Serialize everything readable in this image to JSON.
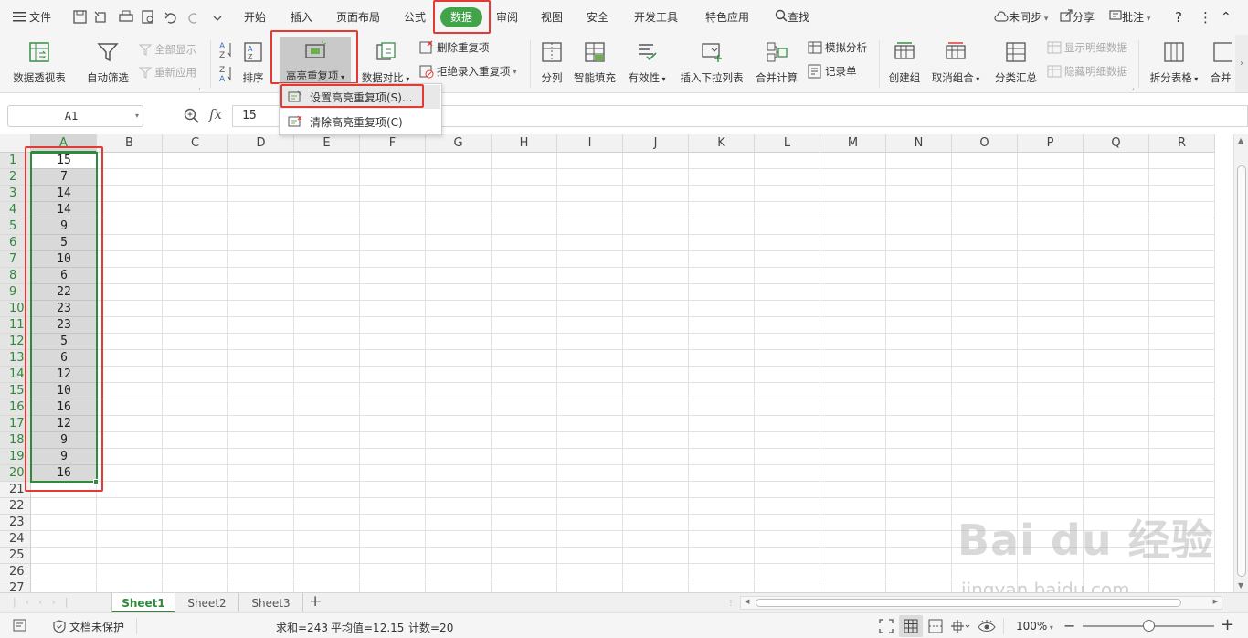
{
  "menu": {
    "file_label": "文件",
    "tabs": [
      "开始",
      "插入",
      "页面布局",
      "公式",
      "数据",
      "审阅",
      "视图",
      "安全",
      "开发工具",
      "特色应用"
    ],
    "active_tab": "数据",
    "search_label": "查找",
    "sync_label": "未同步",
    "share_label": "分享",
    "comment_label": "批注",
    "help_label": "?"
  },
  "ribbon": {
    "pivot": "数据透视表",
    "autofilter": "自动筛选",
    "show_all": "全部显示",
    "reapply": "重新应用",
    "sort": "排序",
    "highlight_dup": "高亮重复项",
    "compare": "数据对比",
    "delete_dup": "删除重复项",
    "reject_dup": "拒绝录入重复项",
    "split_col": "分列",
    "smart_fill": "智能填充",
    "validity": "有效性",
    "insert_dropdown": "插入下拉列表",
    "consolidate": "合并计算",
    "whatif": "模拟分析",
    "record": "记录单",
    "create_group": "创建组",
    "ungroup": "取消组合",
    "subtotal": "分类汇总",
    "show_detail": "显示明细数据",
    "hide_detail": "隐藏明细数据",
    "split_table": "拆分表格",
    "merge_table": "合并"
  },
  "dropdown": {
    "set_highlight": "设置高亮重复项(S)...",
    "clear_highlight": "清除高亮重复项(C)"
  },
  "formula": {
    "name_box": "A1",
    "fx": "fx",
    "value": "15"
  },
  "grid": {
    "columns": [
      "A",
      "B",
      "C",
      "D",
      "E",
      "F",
      "G",
      "H",
      "I",
      "J",
      "K",
      "L",
      "M",
      "N",
      "O",
      "P",
      "Q",
      "R"
    ],
    "rows": [
      "1",
      "2",
      "3",
      "4",
      "5",
      "6",
      "7",
      "8",
      "9",
      "10",
      "11",
      "12",
      "13",
      "14",
      "15",
      "16",
      "17",
      "18",
      "19",
      "20",
      "21",
      "22",
      "23",
      "24",
      "25",
      "26",
      "27"
    ],
    "column_a_values": [
      "15",
      "7",
      "14",
      "14",
      "9",
      "5",
      "10",
      "6",
      "22",
      "23",
      "23",
      "5",
      "6",
      "12",
      "10",
      "16",
      "12",
      "9",
      "9",
      "16"
    ]
  },
  "sheets": [
    "Sheet1",
    "Sheet2",
    "Sheet3"
  ],
  "active_sheet": "Sheet1",
  "status": {
    "protect": "文档未保护",
    "sum": "求和=243",
    "avg": "平均值=12.15",
    "count": "计数=20",
    "zoom": "100%"
  },
  "watermark": {
    "line1": "Bai du 经验",
    "line2": "jingyan.baidu.com"
  },
  "colors": {
    "active_tab_bg": "#41a34a",
    "selection_border": "#2e8b3a",
    "highlight_box": "#e53935",
    "selected_cell_bg": "#d9d9d9"
  }
}
